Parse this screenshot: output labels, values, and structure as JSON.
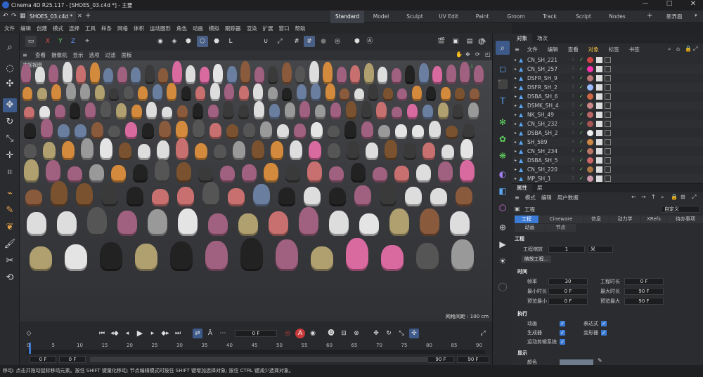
{
  "titlebar": {
    "app_title": "Cinema 4D R25.117 - [SHOES_03.c4d *] - 主要"
  },
  "doc_tab": {
    "name": "SHOES_03.c4d *",
    "add": "+"
  },
  "layouts": [
    "Standard",
    "Model",
    "Sculpt",
    "UV Edit",
    "Paint",
    "Groom",
    "Track",
    "Script",
    "Nodes"
  ],
  "layout_add": "+",
  "layout_new": "新界面",
  "menu": [
    "文件",
    "编辑",
    "创建",
    "模式",
    "选择",
    "工具",
    "样条",
    "网格",
    "体积",
    "运动图形",
    "角色",
    "动画",
    "模拟",
    "跟踪器",
    "渲染",
    "扩展",
    "窗口",
    "帮助"
  ],
  "toptool": {
    "axis_x": "X",
    "axis_y": "Y",
    "axis_z": "Z"
  },
  "viewport_menu": [
    "查看",
    "摄像机",
    "显示",
    "选项",
    "过滤",
    "面板"
  ],
  "viewport": {
    "label": "透视视图",
    "grid_spacing": "网格间距 : 100 cm"
  },
  "objpanel": {
    "tabs": [
      "对象",
      "场次"
    ],
    "menu": [
      "文件",
      "编辑",
      "查看",
      "对象",
      "标签",
      "书签"
    ],
    "objects": [
      "CN_SH_221",
      "CN_SH_257",
      "DSFR_SH_9",
      "DSFR_SH_2",
      "DSBA_SH_6",
      "DSMK_SH_4",
      "NK_SH_49",
      "CN_SH_232",
      "DSBA_SH_2",
      "SH_589",
      "CN_SH_234",
      "DSBA_SH_5",
      "CN_SH_220",
      "MP_SH_1"
    ]
  },
  "attrpanel": {
    "tabs": [
      "属性",
      "层"
    ],
    "menu": [
      "模式",
      "编辑",
      "用户数据"
    ],
    "object_title": "工程",
    "preset": "自定义",
    "tabs_row1": [
      "工程",
      "Cineware",
      "信息",
      "动力学",
      "XRefs",
      "待办事项"
    ],
    "tabs_row2": [
      "动画",
      "节点"
    ],
    "section_project": "工程",
    "project_scale_label": "工程缩放",
    "project_scale_value": "1",
    "project_scale_unit": "米",
    "scale_project_button": "缩放工程...",
    "section_time": "时间",
    "fps_label": "帧率",
    "fps_value": "30",
    "project_length_label": "工程时长",
    "project_length_value": "0 F",
    "min_time_label": "最小时长",
    "min_time_value": "0 F",
    "max_time_label": "最大时长",
    "max_time_value": "90 F",
    "preview_min_label": "预览最小",
    "preview_min_value": "0 F",
    "preview_max_label": "预览最大",
    "preview_max_value": "90 F",
    "section_exec": "执行",
    "animation_label": "动画",
    "expressions_label": "表达式",
    "generators_label": "生成器",
    "deformers_label": "变形器",
    "motion_system_label": "运动剪辑系统",
    "section_display": "显示",
    "color_label": "颜色"
  },
  "timeline": {
    "current_frame": "0 F",
    "ticks": [
      "0",
      "5",
      "10",
      "15",
      "20",
      "25",
      "30",
      "35",
      "40",
      "45",
      "50",
      "55",
      "60",
      "65",
      "70",
      "75",
      "80",
      "85",
      "90"
    ],
    "start_frame": "0 F",
    "start_frame2": "0 F",
    "end_frame": "90 F",
    "end_frame2": "90 F"
  },
  "statusbar": {
    "text": "移动: 点击并拖动鼠标移动元素。按住 SHIFT 键量化移动; 节点编辑模式时按住 SHIFT 键增加选择对象; 按住 CTRL 键减少选择对象。"
  },
  "colors": {
    "accent": "#3b7bd6",
    "panel": "#2b2c2f",
    "viewport": "#3b3c3f"
  }
}
